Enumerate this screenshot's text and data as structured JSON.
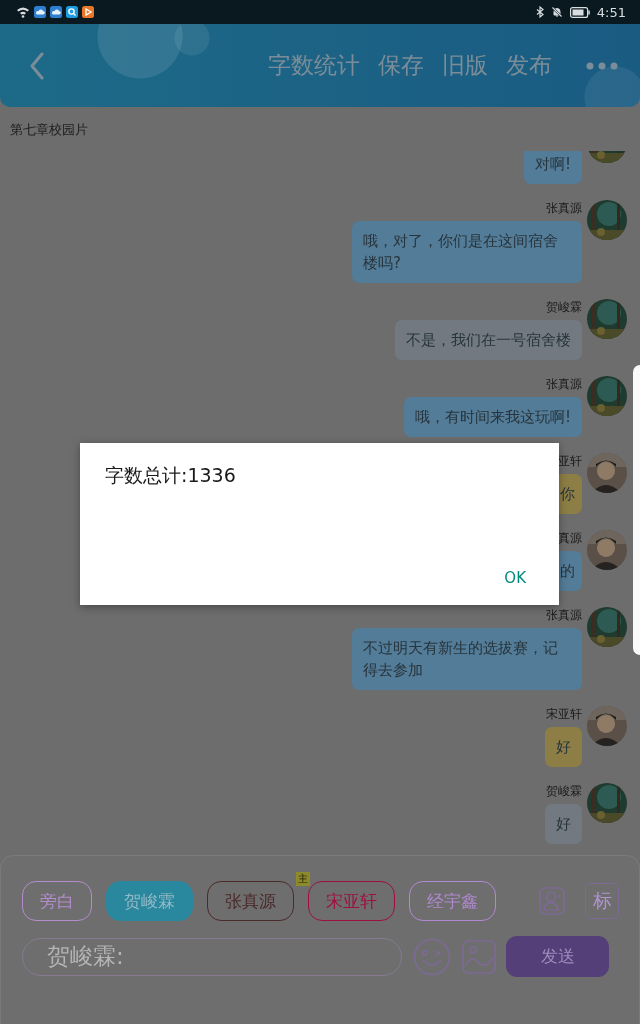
{
  "status_bar": {
    "time": "4:51"
  },
  "header": {
    "actions": [
      "字数统计",
      "保存",
      "旧版",
      "发布"
    ]
  },
  "chapter_title": "第七章校园片",
  "messages": [
    {
      "text": "对啊!",
      "color": "#537c98",
      "partial": false
    },
    {
      "name": "张真源",
      "text": "哦，对了，你们是在这间宿舍楼吗?",
      "color": "#537c98",
      "partial": false
    },
    {
      "name": "贺峻霖",
      "text": "不是，我们在一号宿舍楼",
      "color": "#727980",
      "partial": false
    },
    {
      "name": "张真源",
      "text": "哦，有时间来我这玩啊!",
      "color": "#537c98",
      "partial": false
    },
    {
      "name": "亚轩",
      "text": "你",
      "color": "#8d7e45",
      "partial": true
    },
    {
      "name": "真源",
      "text": "的",
      "color": "#537c98",
      "partial": true
    },
    {
      "name": "张真源",
      "text": "不过明天有新生的选拔赛，记得去参加",
      "color": "#537c98",
      "partial": false
    },
    {
      "name": "宋亚轩",
      "text": "好",
      "color": "#8d7e45",
      "partial": false
    },
    {
      "name": "贺峻霖",
      "text": "好",
      "color": "#727980",
      "partial": false
    }
  ],
  "roles": [
    {
      "label": "旁白",
      "selected": false,
      "color": "#b48ccc"
    },
    {
      "label": "贺峻霖",
      "selected": true,
      "color": "#2a889e"
    },
    {
      "label": "张真源",
      "selected": false,
      "color": "#4a2a2a"
    },
    {
      "label": "宋亚轩",
      "selected": false,
      "color": "#9e1040",
      "badge": "主"
    },
    {
      "label": "经宇鑫",
      "selected": false,
      "color": "#b08ad0"
    }
  ],
  "mark_button": "标",
  "input": {
    "value": "贺峻霖:"
  },
  "send_button": "发送",
  "dialog": {
    "message": "字数总计:1336",
    "button": "OK"
  }
}
